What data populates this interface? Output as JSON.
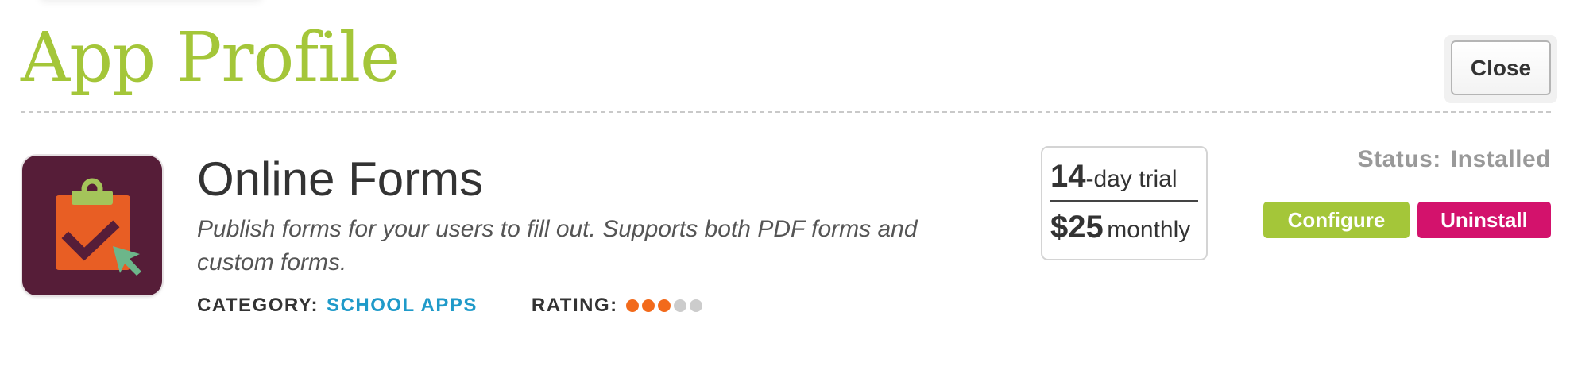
{
  "header": {
    "title": "App Profile",
    "close_label": "Close"
  },
  "app": {
    "name": "Online Forms",
    "description": "Publish forms for your users to fill out. Supports both PDF forms and custom forms.",
    "icon": "clipboard-check-cursor-icon",
    "category_label": "CATEGORY:",
    "category_value": "SCHOOL APPS",
    "rating_label": "RATING:",
    "rating": 3,
    "rating_max": 5
  },
  "pricing": {
    "trial_days": "14",
    "trial_text": "-day trial",
    "price": "$25",
    "period": "monthly"
  },
  "status": {
    "label": "Status:",
    "value": "Installed"
  },
  "actions": {
    "configure_label": "Configure",
    "uninstall_label": "Uninstall"
  },
  "colors": {
    "title_green": "#a4c639",
    "configure_green": "#a4c639",
    "uninstall_magenta": "#d3126c",
    "category_link_blue": "#1f9ac9",
    "rating_orange": "#f26a1b",
    "rating_empty_gray": "#cccccc",
    "icon_background": "#561d38",
    "status_gray": "#999999"
  }
}
